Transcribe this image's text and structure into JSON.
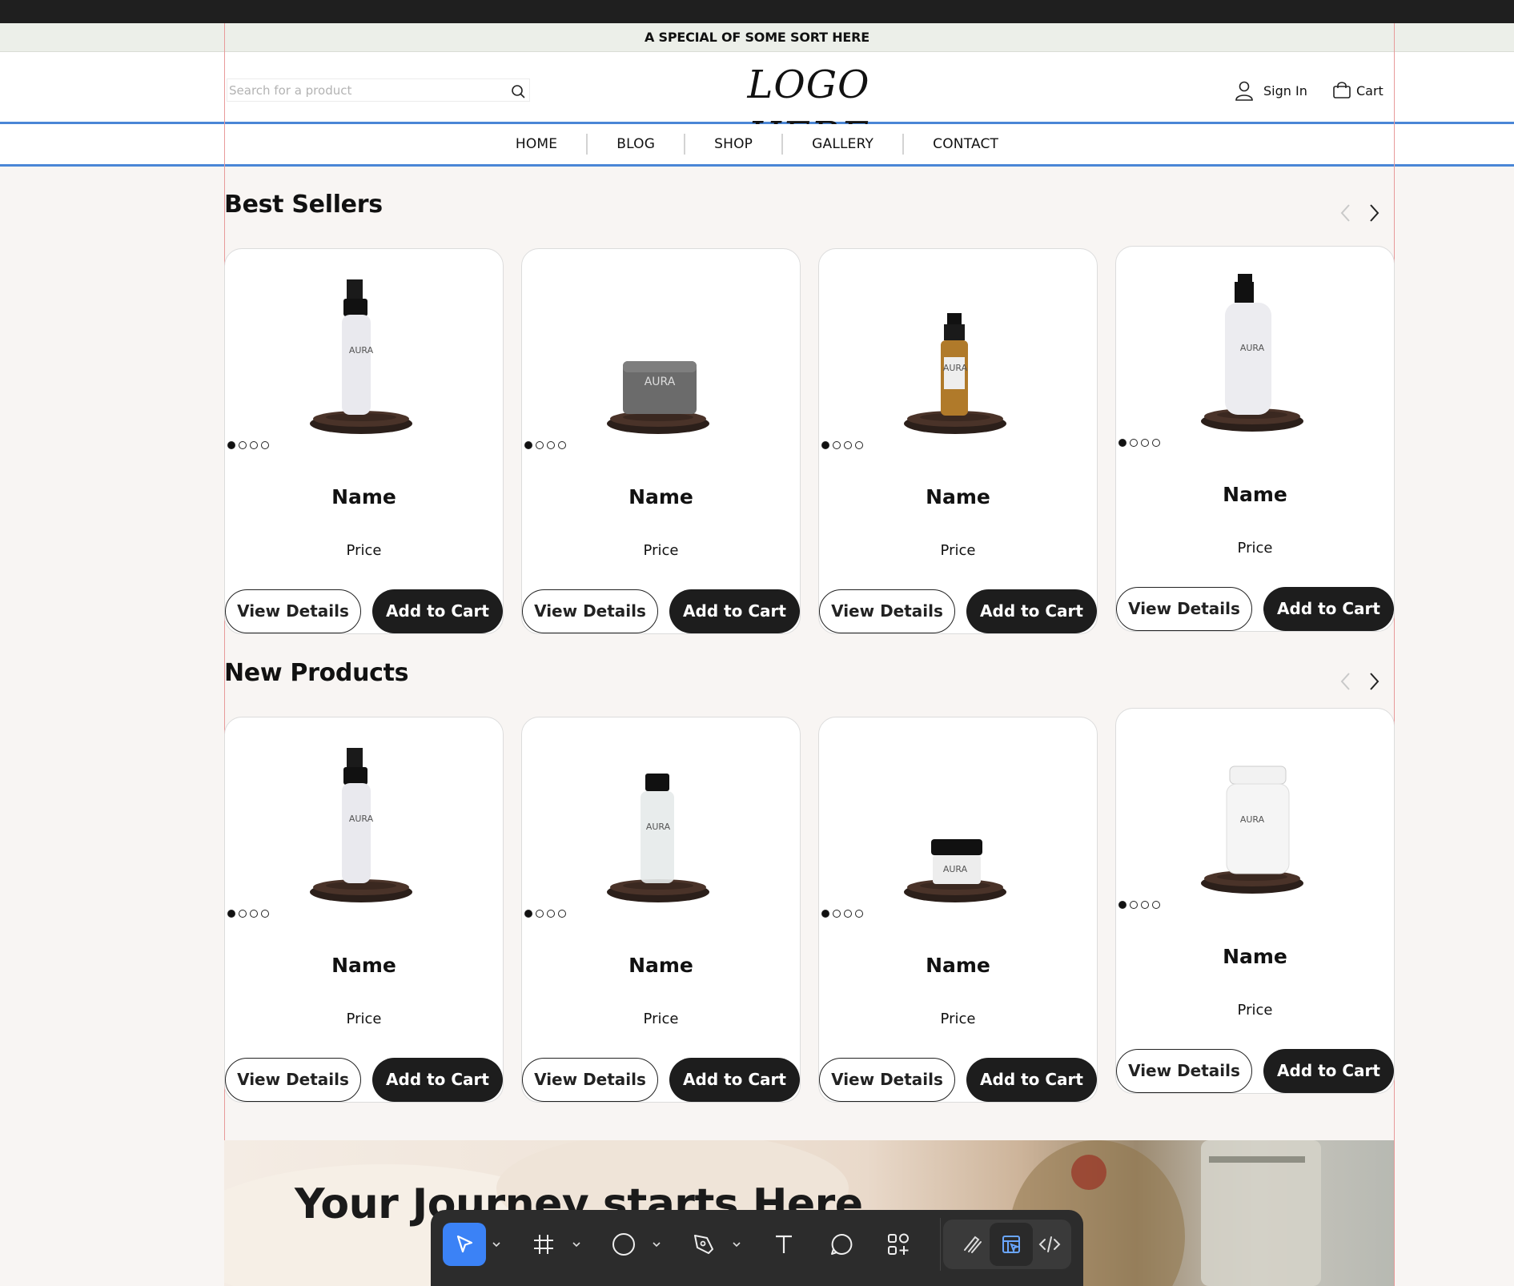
{
  "promo": {
    "text": "A SPECIAL OF SOME SORT HERE"
  },
  "header": {
    "search_placeholder": "Search for a product",
    "logo": "LOGO HERE",
    "signin": "Sign In",
    "cart": "Cart"
  },
  "nav": {
    "items": [
      "HOME",
      "BLOG",
      "SHOP",
      "GALLERY",
      "CONTACT"
    ]
  },
  "sections": {
    "best": {
      "title": "Best Sellers",
      "products": [
        {
          "name": "Name",
          "price": "Price",
          "view": "View Details",
          "add": "Add to Cart",
          "img": "spray-bottle"
        },
        {
          "name": "Name",
          "price": "Price",
          "view": "View Details",
          "add": "Add to Cart",
          "img": "soap-bar"
        },
        {
          "name": "Name",
          "price": "Price",
          "view": "View Details",
          "add": "Add to Cart",
          "img": "serum-bottle"
        },
        {
          "name": "Name",
          "price": "Price",
          "view": "View Details",
          "add": "Add to Cart",
          "img": "pump-bottle"
        }
      ]
    },
    "new": {
      "title": "New Products",
      "products": [
        {
          "name": "Name",
          "price": "Price",
          "view": "View Details",
          "add": "Add to Cart",
          "img": "spray-bottle"
        },
        {
          "name": "Name",
          "price": "Price",
          "view": "View Details",
          "add": "Add to Cart",
          "img": "small-vial"
        },
        {
          "name": "Name",
          "price": "Price",
          "view": "View Details",
          "add": "Add to Cart",
          "img": "cream-jar"
        },
        {
          "name": "Name",
          "price": "Price",
          "view": "View Details",
          "add": "Add to Cart",
          "img": "supplement-jar"
        }
      ]
    }
  },
  "hero": {
    "title": "Your Journey starts Here"
  },
  "colors": {
    "accent": "#4a86d6",
    "dark": "#1d1d1d",
    "promo_bg": "#ecefe9",
    "page_bg": "#f8f5f3",
    "tool_active": "#3b82f6"
  },
  "toolbar": {
    "tools": [
      "move-tool-icon",
      "frame-tool-icon",
      "ellipse-tool-icon",
      "pen-tool-icon",
      "text-tool-icon",
      "comment-tool-icon",
      "components-tool-icon",
      "draw-mode-icon",
      "design-mode-icon",
      "dev-mode-icon"
    ]
  }
}
